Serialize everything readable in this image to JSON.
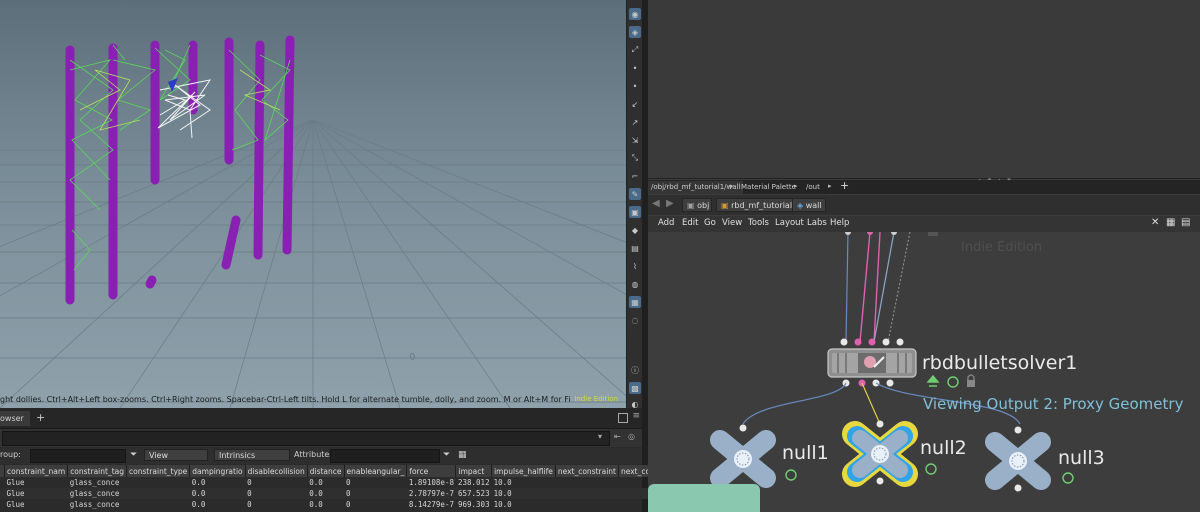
{
  "viewport": {
    "hint": "ght dollies. Ctrl+Alt+Left box-zooms. Ctrl+Right zooms. Spacebar-Ctrl-Left tilts. Hold L for alternate tumble, dolly, and zoom. M or Alt+M for First Person Navigation.",
    "edition_mark": "Indie Edition"
  },
  "viewport_toolbar": {
    "icons": [
      "select-icon",
      "view-icon",
      "handle-icon",
      "dot-icon",
      "dot-icon",
      "brush-icon",
      "edit-icon",
      "transform-icon",
      "pose-icon",
      "camera-icon",
      "paint-icon",
      "snap-icon",
      "ghost-icon",
      "grid-icon",
      "light-icon",
      "wire-icon",
      "display-icon",
      "scene-icon",
      "info-icon",
      "camera-settings-icon",
      "display-options-icon"
    ]
  },
  "spreadsheet": {
    "tab_label": "owser",
    "add_tab": "+",
    "filter": {
      "group_label": "roup:",
      "view_label": "View",
      "intrinsics_label": "Intrinsics",
      "attributes_label": "Attributes:"
    },
    "columns": [
      "constraint_nam",
      "constraint_tag",
      "constraint_type",
      "dampingratio",
      "disablecollision",
      "distance",
      "enableangular_",
      "force",
      "impact",
      "impulse_halflife",
      "next_constraint",
      "next_cons"
    ],
    "rows": [
      [
        "Glue",
        "glass_conce",
        "",
        "0.0",
        "0",
        "0.0",
        "0",
        "1.89108e-8",
        "238.012",
        "10.0",
        "",
        ""
      ],
      [
        "Glue",
        "glass_conce",
        "",
        "0.0",
        "0",
        "0.0",
        "0",
        "2.78797e-7",
        "657.523",
        "10.0",
        "",
        ""
      ],
      [
        "Glue",
        "glass_conce",
        "",
        "0.0",
        "0",
        "0.0",
        "0",
        "8.14279e-7",
        "969.303",
        "10.0",
        "",
        ""
      ]
    ]
  },
  "network": {
    "tabs": [
      {
        "label": "/obj/rbd_mf_tutorial1/wall",
        "active": true
      },
      {
        "label": "Material Palette",
        "active": false
      },
      {
        "label": "/out",
        "active": false
      }
    ],
    "add_tab": "+",
    "path": {
      "root": "obj",
      "parent": "rbd_mf_tutorial1",
      "current": "wall"
    },
    "menu": [
      "Add",
      "Edit",
      "Go",
      "View",
      "Tools",
      "Layout",
      "Labs",
      "Help"
    ],
    "watermark": "Indie Edition",
    "nodes": {
      "solver": "rbdbulletsolver1",
      "null1": "null1",
      "null2": "null2",
      "null3": "null3"
    },
    "viewing_note": "Viewing Output 2: Proxy Geometry",
    "colors": {
      "accent_blue": "#7fc0d8",
      "wire_pink": "#e060b0",
      "node_body": "#9ab0c8",
      "node_center": "#e8f0f8",
      "selection_yellow": "#e8d840"
    }
  }
}
